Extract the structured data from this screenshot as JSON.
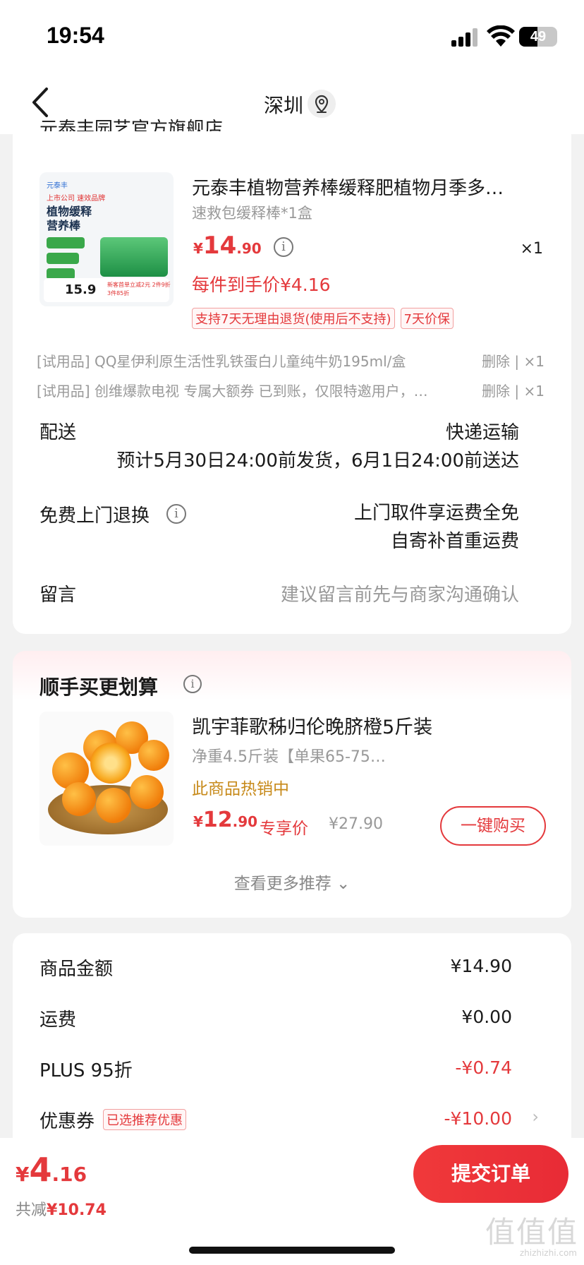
{
  "status_bar": {
    "time": "19:54",
    "battery": "49",
    "battery_level": 0.49
  },
  "nav": {
    "title": "深圳"
  },
  "shop": {
    "name": "元泰丰园艺官方旗舰店"
  },
  "product": {
    "image_brand": "元泰丰",
    "image_tag": "上市公司 速效品牌",
    "image_headline": "植物缓释\n营养棒",
    "image_price": "15.9",
    "image_promo": "新客首单立减2元 2件9折 3件85折",
    "title": "元泰丰植物营养棒缓释肥植物月季多…",
    "spec": "速救包缓释棒*1盒",
    "price_yen": "¥",
    "price_int": "14",
    "price_dec": ".90",
    "qty": "×1",
    "unit_price": "每件到手价¥4.16",
    "badges": [
      "支持7天无理由退货(使用后不支持)",
      "7天价保"
    ]
  },
  "trials": [
    {
      "text": "[试用品] QQ星伊利原生活性乳铁蛋白儿童纯牛奶195ml/盒",
      "action": "删除 | ×1"
    },
    {
      "text": "[试用品] 创维爆款电视 专属大额券 已到账，仅限特邀用户，…",
      "action": "删除 | ×1"
    }
  ],
  "delivery": {
    "label": "配送",
    "method": "快递运输",
    "eta": "预计5月30日24:00前发货，6月1日24:00前送达"
  },
  "return_service": {
    "label": "免费上门退换",
    "line1": "上门取件享运费全免",
    "line2": "自寄补首重运费"
  },
  "message": {
    "label": "留言",
    "placeholder": "建议留言前先与商家沟通确认"
  },
  "recommend": {
    "title": "顺手买更划算",
    "item_title": "凯宇菲歌秭归伦晚脐橙5斤装",
    "item_spec": "净重4.5斤装【单果65-75…",
    "item_hot": "此商品热销中",
    "price_yen": "¥",
    "price_int": "12",
    "price_dec": ".90",
    "exclusive": "专享价",
    "original_price": "¥27.90",
    "buy_label": "一键购买",
    "more_label": "查看更多推荐 ⌄"
  },
  "summary": {
    "goods_label": "商品金额",
    "goods_value": "¥14.90",
    "shipping_label": "运费",
    "shipping_value": "¥0.00",
    "plus_label": "PLUS 95折",
    "plus_value": "-¥0.74",
    "coupon_label": "优惠券",
    "coupon_tag": "已选推荐优惠",
    "coupon_value": "-¥10.00"
  },
  "bottom": {
    "total_yen": "¥",
    "total_int": "4",
    "total_dec": ".16",
    "saved_prefix": "共减",
    "saved_value": "¥10.74",
    "submit_label": "提交订单"
  },
  "watermark": {
    "text": "值值值",
    "url": "zhizhizhi.com"
  },
  "colors": {
    "accent": "#e4393c",
    "hot": "#c78a1a",
    "background": "#f2f2f2"
  }
}
